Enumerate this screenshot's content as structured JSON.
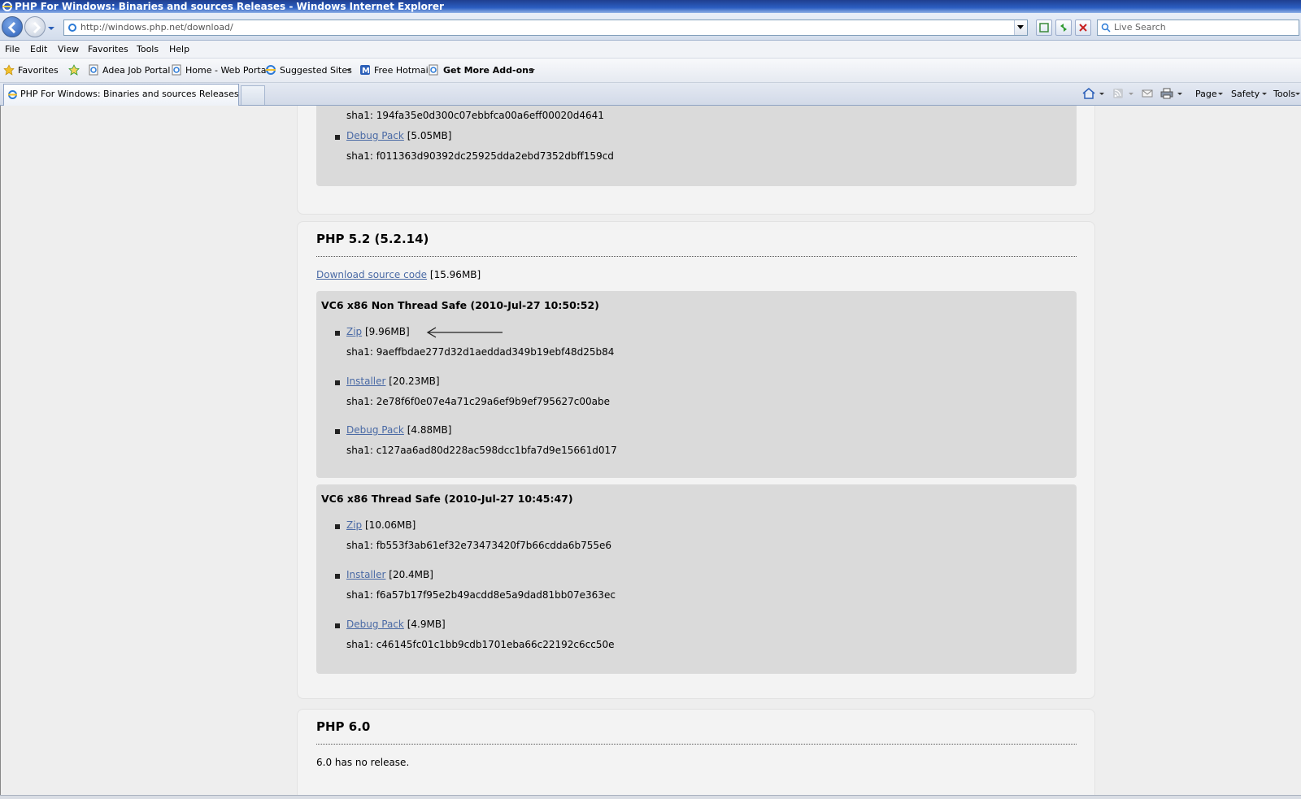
{
  "window": {
    "title": "PHP For Windows: Binaries and sources Releases - Windows Internet Explorer"
  },
  "address_bar": {
    "url": "http://windows.php.net/download/"
  },
  "search": {
    "placeholder": "Live Search"
  },
  "menu": [
    "File",
    "Edit",
    "View",
    "Favorites",
    "Tools",
    "Help"
  ],
  "favorites_bar": {
    "favorites_label": "Favorites",
    "links": [
      "Adea Job Portal",
      "Home - Web Portal",
      "Suggested Sites",
      "Free Hotmail",
      "Get More Add-ons"
    ]
  },
  "tab": {
    "title": "PHP For Windows: Binaries and sources Releases"
  },
  "command_bar": {
    "page": "Page",
    "safety": "Safety",
    "tools": "Tools"
  },
  "content": {
    "top_partial": {
      "cut_sha": "sha1: 194fa35e0d300c07ebbfca00a6eff00020d4641",
      "debug_pack": {
        "label": "Debug Pack",
        "size": "[5.05MB]",
        "sha": "sha1: f011363d90392dc25925dda2ebd7352dbff159cd"
      }
    },
    "php52": {
      "title": "PHP 5.2 (5.2.14)",
      "source_link": "Download source code",
      "source_size": "[15.96MB]",
      "nts": {
        "title": "VC6 x86 Non Thread Safe (2010-Jul-27 10:50:52)",
        "items": [
          {
            "label": "Zip",
            "size": "[9.96MB]",
            "sha": "sha1: 9aeffbdae277d32d1aeddad349b19ebf48d25b84"
          },
          {
            "label": "Installer",
            "size": "[20.23MB]",
            "sha": "sha1: 2e78f6f0e07e4a71c29a6ef9b9ef795627c00abe"
          },
          {
            "label": "Debug Pack",
            "size": "[4.88MB]",
            "sha": "sha1: c127aa6ad80d228ac598dcc1bfa7d9e15661d017"
          }
        ]
      },
      "ts": {
        "title": "VC6 x86 Thread Safe (2010-Jul-27 10:45:47)",
        "items": [
          {
            "label": "Zip",
            "size": "[10.06MB]",
            "sha": "sha1: fb553f3ab61ef32e73473420f7b66cdda6b755e6"
          },
          {
            "label": "Installer",
            "size": "[20.4MB]",
            "sha": "sha1: f6a57b17f95e2b49acdd8e5a9dad81bb07e363ec"
          },
          {
            "label": "Debug Pack",
            "size": "[4.9MB]",
            "sha": "sha1: c46145fc01c1bb9cdb1701eba66c22192c6cc50e"
          }
        ]
      }
    },
    "php60": {
      "title": "PHP 6.0",
      "text": "6.0 has no release."
    }
  }
}
